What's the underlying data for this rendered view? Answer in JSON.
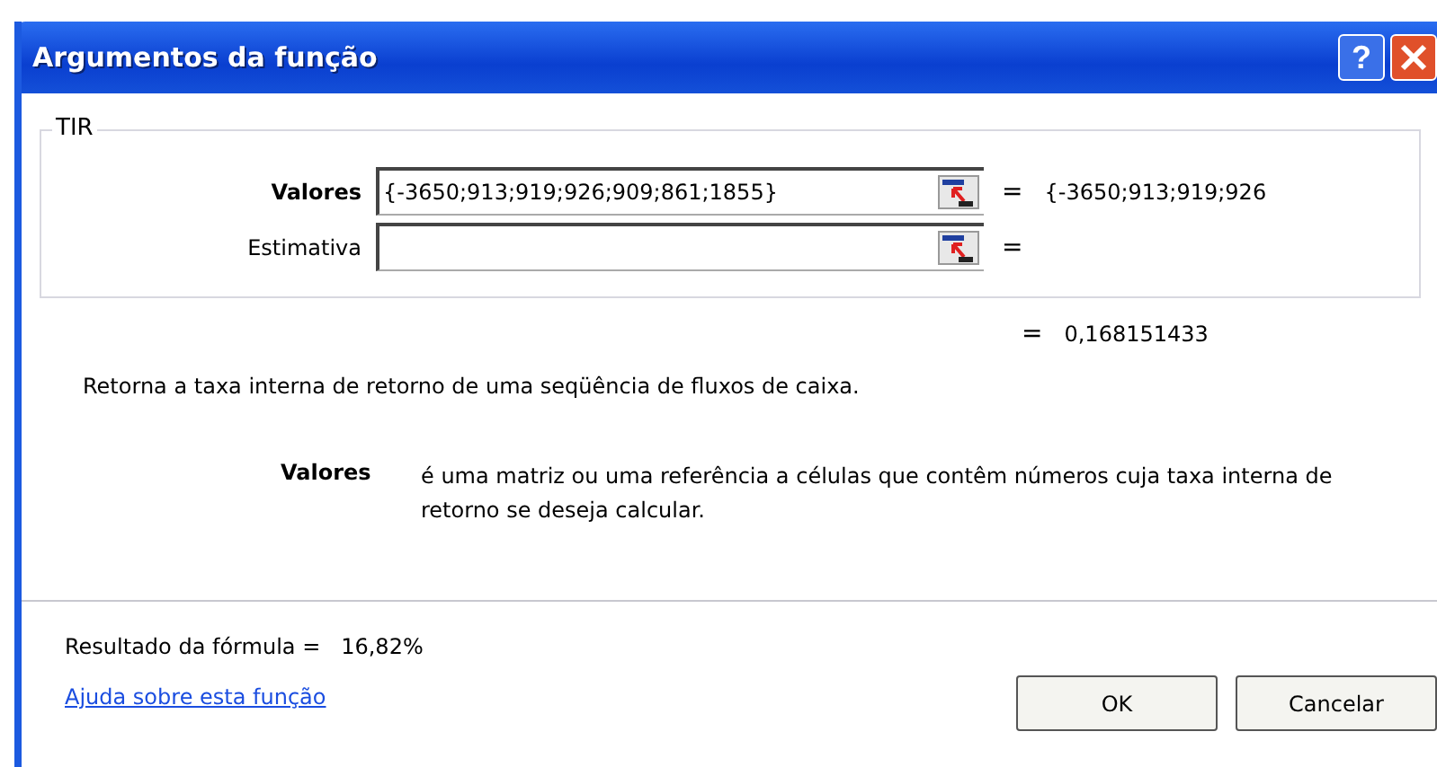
{
  "window": {
    "title": "Argumentos da função",
    "help_button": "?"
  },
  "group": {
    "title": "TIR",
    "arguments": [
      {
        "label": "Valores",
        "bold": true,
        "value": "{-3650;913;919;926;909;861;1855}",
        "equals": "=",
        "result": "{-3650;913;919;926"
      },
      {
        "label": "Estimativa",
        "bold": false,
        "equals": "="
      }
    ]
  },
  "function_result": {
    "equals": "=",
    "value": "0,168151433"
  },
  "description": "Retorna a taxa interna de retorno de uma seqüência de fluxos de caixa.",
  "argument_help": {
    "name": "Valores",
    "text": "é uma matriz ou uma referência a células que contêm números cuja taxa interna de retorno se deseja calcular."
  },
  "formula_result": {
    "label": "Resultado da fórmula =",
    "value": "16,82%"
  },
  "help_link": "Ajuda sobre esta função",
  "buttons": [
    "OK",
    "Cancelar"
  ]
}
